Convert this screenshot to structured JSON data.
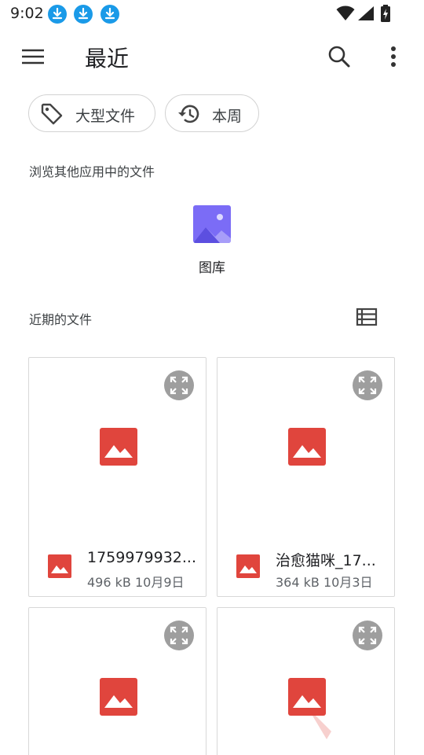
{
  "status": {
    "time": "9:02",
    "icons": [
      "download-icon",
      "download-icon",
      "download-icon",
      "wifi-icon",
      "signal-icon",
      "battery-charging-icon"
    ]
  },
  "toolbar": {
    "title": "最近",
    "icons": [
      "menu-icon",
      "search-icon",
      "more-vert-icon"
    ]
  },
  "chips": [
    {
      "label": "大型文件",
      "icon": "tag-icon"
    },
    {
      "label": "本周",
      "icon": "history-icon"
    }
  ],
  "browse_section": {
    "title": "浏览其他应用中的文件",
    "apps": [
      {
        "label": "图库",
        "icon": "gallery-icon"
      }
    ]
  },
  "recent_section": {
    "title": "近期的文件",
    "view_toggle_icon": "list-view-icon"
  },
  "files": [
    {
      "name": "1759979932...",
      "size": "496 kB",
      "date": "10月9日",
      "icon": "image-icon"
    },
    {
      "name": "治愈猫咪_17...",
      "size": "364 kB",
      "date": "10月3日",
      "icon": "image-icon"
    },
    {
      "name": "",
      "size": "",
      "date": "",
      "icon": "image-icon"
    },
    {
      "name": "",
      "size": "",
      "date": "",
      "icon": "image-icon"
    }
  ],
  "colors": {
    "accent_download": "#1a9ae8",
    "image_icon_red": "#e0453d",
    "gallery_purple": "#7b6cf6",
    "expand_button_gray": "#9e9e9e"
  }
}
